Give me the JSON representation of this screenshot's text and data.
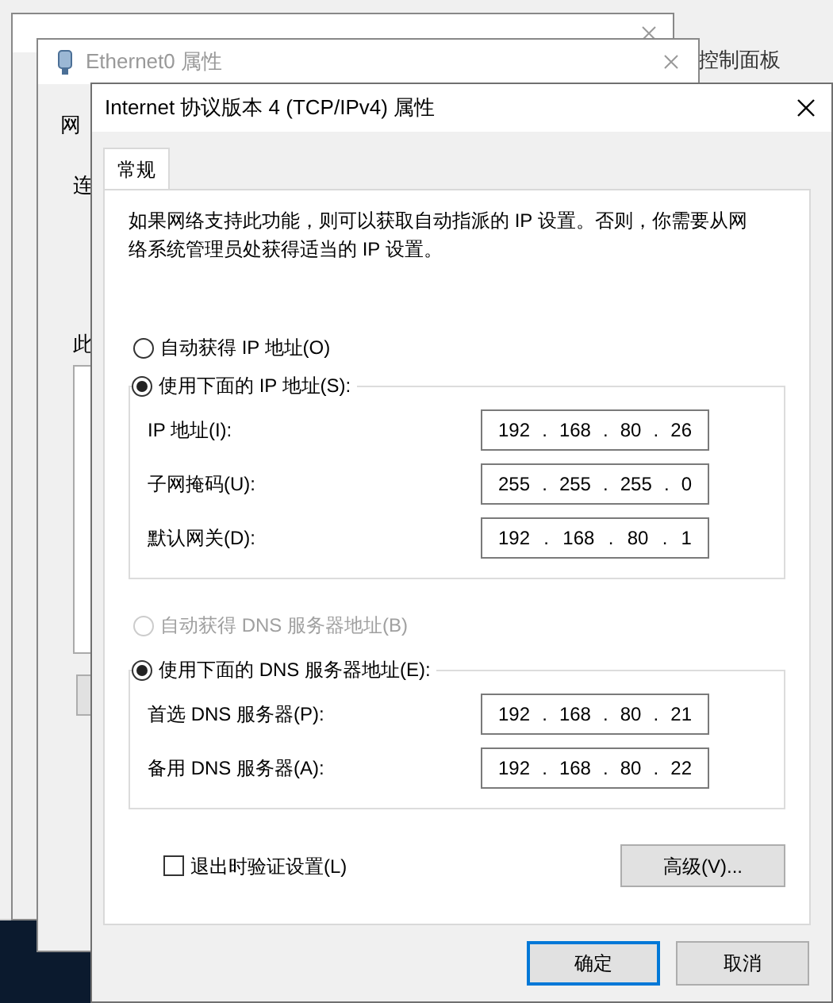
{
  "control_panel": {
    "fragments": [
      "控制面板"
    ]
  },
  "background_windows": [
    {
      "title": "Ethernet0 属性",
      "labels": [
        "网",
        "连",
        "此"
      ]
    }
  ],
  "dialog": {
    "title": "Internet 协议版本 4 (TCP/IPv4) 属性",
    "tabs": [
      {
        "label": "常规",
        "selected": true
      }
    ],
    "description": "如果网络支持此功能，则可以获取自动指派的 IP 设置。否则，你需要从网络系统管理员处获得适当的 IP 设置。",
    "ip_options": [
      {
        "label": "自动获得 IP 地址(O)",
        "selected": false,
        "disabled": false
      },
      {
        "label": "使用下面的 IP 地址(S):",
        "selected": true,
        "disabled": false
      }
    ],
    "ip_fields": [
      {
        "label": "IP 地址(I):",
        "octets": [
          "192",
          "168",
          "80",
          "26"
        ]
      },
      {
        "label": "子网掩码(U):",
        "octets": [
          "255",
          "255",
          "255",
          "0"
        ]
      },
      {
        "label": "默认网关(D):",
        "octets": [
          "192",
          "168",
          "80",
          "1"
        ]
      }
    ],
    "dns_options": [
      {
        "label": "自动获得 DNS 服务器地址(B)",
        "selected": false,
        "disabled": true
      },
      {
        "label": "使用下面的 DNS 服务器地址(E):",
        "selected": true,
        "disabled": false
      }
    ],
    "dns_fields": [
      {
        "label": "首选 DNS 服务器(P):",
        "octets": [
          "192",
          "168",
          "80",
          "21"
        ]
      },
      {
        "label": "备用 DNS 服务器(A):",
        "octets": [
          "192",
          "168",
          "80",
          "22"
        ]
      }
    ],
    "separator": ".",
    "validate": {
      "label": "退出时验证设置(L)",
      "checked": false
    },
    "advanced_button": "高级(V)...",
    "buttons": [
      {
        "label": "确定",
        "default": true
      },
      {
        "label": "取消",
        "default": false
      }
    ]
  }
}
